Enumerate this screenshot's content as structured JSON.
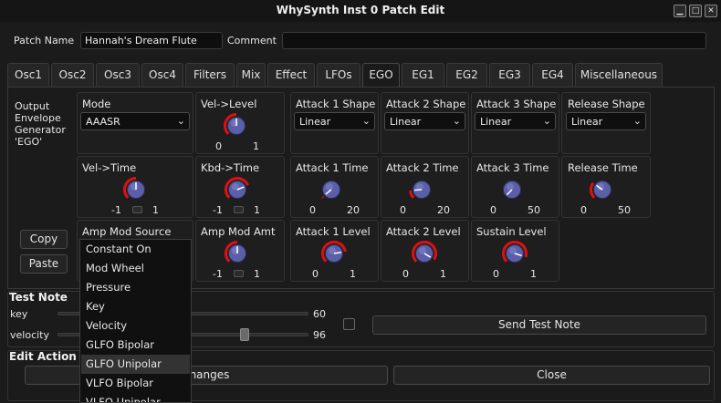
{
  "window": {
    "title": "WhySynth Inst 0 Patch Edit"
  },
  "header": {
    "patch_name_label": "Patch Name",
    "patch_name_value": "Hannah's Dream Flute",
    "comment_label": "Comment",
    "comment_value": ""
  },
  "tabs": [
    "Osc1",
    "Osc2",
    "Osc3",
    "Osc4",
    "Filters",
    "Mix",
    "Effect",
    "LFOs",
    "EGO",
    "EG1",
    "EG2",
    "EG3",
    "EG4",
    "Miscellaneous"
  ],
  "active_tab": "EGO",
  "ego": {
    "description": "Output\nEnvelope\nGenerator\n'EGO'",
    "mode": {
      "label": "Mode",
      "value": "AAASR"
    },
    "vel_level": {
      "label": "Vel->Level",
      "min": "0",
      "max": "1",
      "value": 0.5
    },
    "vel_time": {
      "label": "Vel->Time",
      "min": "-1",
      "max": "1",
      "value": 0.5
    },
    "kbd_time": {
      "label": "Kbd->Time",
      "min": "-1",
      "max": "1",
      "value": 0.75
    },
    "amp_mod_source": {
      "label": "Amp Mod Source"
    },
    "amp_mod_amt": {
      "label": "Amp Mod Amt",
      "min": "-1",
      "max": "1",
      "value": 0.5
    },
    "attack1_shape": {
      "label": "Attack 1 Shape",
      "value": "Linear"
    },
    "attack2_shape": {
      "label": "Attack 2 Shape",
      "value": "Linear"
    },
    "attack3_shape": {
      "label": "Attack 3 Shape",
      "value": "Linear"
    },
    "release_shape": {
      "label": "Release Shape",
      "value": "Linear"
    },
    "attack1_time": {
      "label": "Attack 1 Time",
      "min": "0",
      "max": "20",
      "value": 0.02
    },
    "attack2_time": {
      "label": "Attack 2 Time",
      "min": "0",
      "max": "20",
      "value": 0.15
    },
    "attack3_time": {
      "label": "Attack 3 Time",
      "min": "0",
      "max": "50",
      "value": 0.0
    },
    "release_time": {
      "label": "Release Time",
      "min": "0",
      "max": "50",
      "value": 0.3
    },
    "attack1_level": {
      "label": "Attack 1 Level",
      "min": "0",
      "max": "1",
      "value": 0.8
    },
    "attack2_level": {
      "label": "Attack 2 Level",
      "min": "0",
      "max": "1",
      "value": 0.95
    },
    "sustain_level": {
      "label": "Sustain Level",
      "min": "0",
      "max": "1",
      "value": 0.9
    },
    "copy_label": "Copy",
    "paste_label": "Paste"
  },
  "dropdown": {
    "items": [
      "Constant On",
      "Mod Wheel",
      "Pressure",
      "Key",
      "Velocity",
      "GLFO Bipolar",
      "GLFO Unipolar",
      "VLFO Bipolar",
      "VLFO Unipolar"
    ],
    "highlighted": "GLFO Unipolar"
  },
  "test_note": {
    "section_label": "Test Note",
    "key_label": "key",
    "key_value": "60",
    "velocity_label": "velocity",
    "velocity_value": "96",
    "send_label": "Send Test Note"
  },
  "edit_action": {
    "section_label": "Edit Action",
    "save_label": "e Changes",
    "close_label": "Close"
  },
  "colors": {
    "knob_body": "#5a5fa8",
    "knob_arc": "#dd1111",
    "background": "#1b1b1b",
    "highlight": "#333333"
  }
}
